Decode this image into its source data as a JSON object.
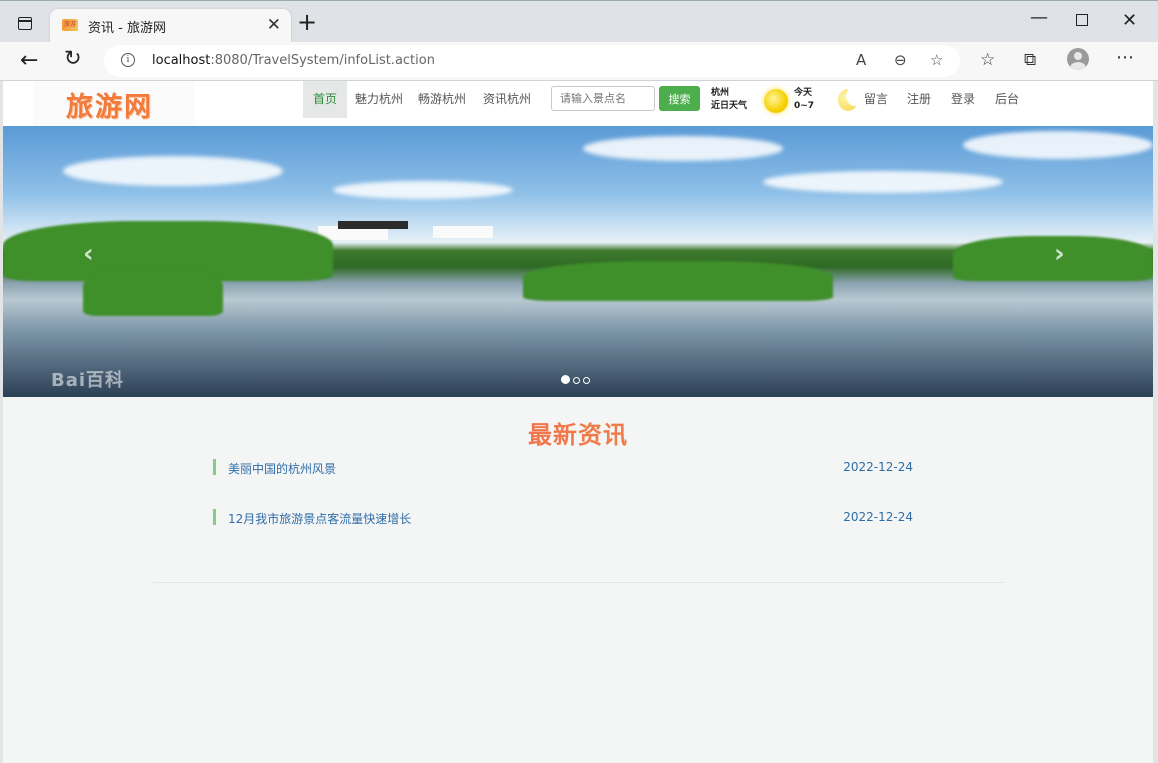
{
  "browser": {
    "tab_title": "资讯 - 旅游网",
    "tab_favicon_text": "旅游",
    "url_host": "localhost",
    "url_rest": ":8080/TravelSystem/infoList.action"
  },
  "site": {
    "logo": "旅游网",
    "nav": [
      {
        "label": "首页",
        "active": true
      },
      {
        "label": "魅力杭州",
        "active": false
      },
      {
        "label": "畅游杭州",
        "active": false
      },
      {
        "label": "资讯杭州",
        "active": false
      }
    ],
    "search": {
      "placeholder": "请输入景点名",
      "button": "搜索"
    },
    "weather": {
      "city": "杭州",
      "subtitle": "近日天气",
      "today_label": "今天",
      "today_temp": "0~7"
    },
    "right_links": [
      "留言",
      "注册",
      "登录",
      "后台"
    ]
  },
  "banner": {
    "watermark": "Bai百科",
    "prev_arrow": "‹",
    "next_arrow": "›",
    "slides": 3,
    "active_slide": 1
  },
  "section": {
    "title": "最新资讯",
    "items": [
      {
        "title": "美丽中国的杭州风景",
        "date": "2022-12-24"
      },
      {
        "title": "12月我市旅游景点客流量快速增长",
        "date": "2022-12-24"
      }
    ]
  },
  "colors": {
    "accent_green": "#4cae4c",
    "link_blue": "#2f6da8",
    "title_gradient": [
      "#e9336d",
      "#f6a23a"
    ]
  }
}
